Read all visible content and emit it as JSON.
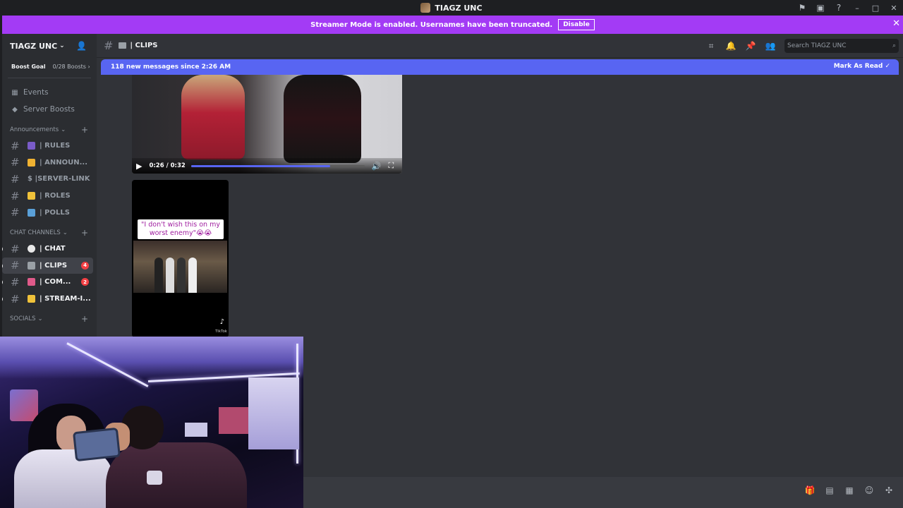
{
  "window": {
    "title": "TIAGZ UNC"
  },
  "streamer_banner": {
    "text": "Streamer Mode is enabled. Usernames have been truncated.",
    "disable_label": "Disable"
  },
  "server": {
    "name": "TIAGZ UNC",
    "boost_goal_label": "Boost Goal",
    "boost_count": "0/28 Boosts ›"
  },
  "sidebar": {
    "nav": [
      {
        "label": "Events",
        "icon": "calendar-icon"
      },
      {
        "label": "Server Boosts",
        "icon": "boost-gem-icon"
      }
    ],
    "categories": [
      {
        "name": "Announcements",
        "channels": [
          {
            "name": "| RULES",
            "emoji_color": "#7a5cc8"
          },
          {
            "name": "| ANNOUN...",
            "emoji_color": "#f0b232"
          },
          {
            "name": "$ |SERVER-LINK",
            "emoji_color": ""
          },
          {
            "name": "| ROLES",
            "emoji_color": "#f0c23a"
          },
          {
            "name": "| POLLS",
            "emoji_color": "#5aa0d8"
          }
        ]
      },
      {
        "name": "CHAT CHANNELS",
        "channels": [
          {
            "name": "| CHAT",
            "emoji_color": "#e8e8e8",
            "unread": true
          },
          {
            "name": "| CLIPS",
            "emoji_color": "#9aa0a6",
            "active": true,
            "badge": "4"
          },
          {
            "name": "| COM...",
            "emoji_color": "#e05a8a",
            "unread": true,
            "badge": "2"
          },
          {
            "name": "| STREAM-I...",
            "emoji_color": "#f0c23a",
            "unread": true
          }
        ]
      },
      {
        "name": "SOCIALS",
        "channels": []
      }
    ]
  },
  "header": {
    "channel_name": "| CLIPS",
    "search_placeholder": "Search TIAGZ UNC"
  },
  "new_messages": {
    "text": "118 new messages since 2:26 AM",
    "mark_read_label": "Mark As Read"
  },
  "video": {
    "time": "0:26 / 0:32",
    "progress": 0.8
  },
  "tiktok": {
    "caption": "\"I don't wish this on my worst enemy\"😭😭",
    "brand": "TikTok"
  },
  "colors": {
    "accent": "#5865f2",
    "streamer": "#a33bf5",
    "badge": "#f23f43"
  }
}
